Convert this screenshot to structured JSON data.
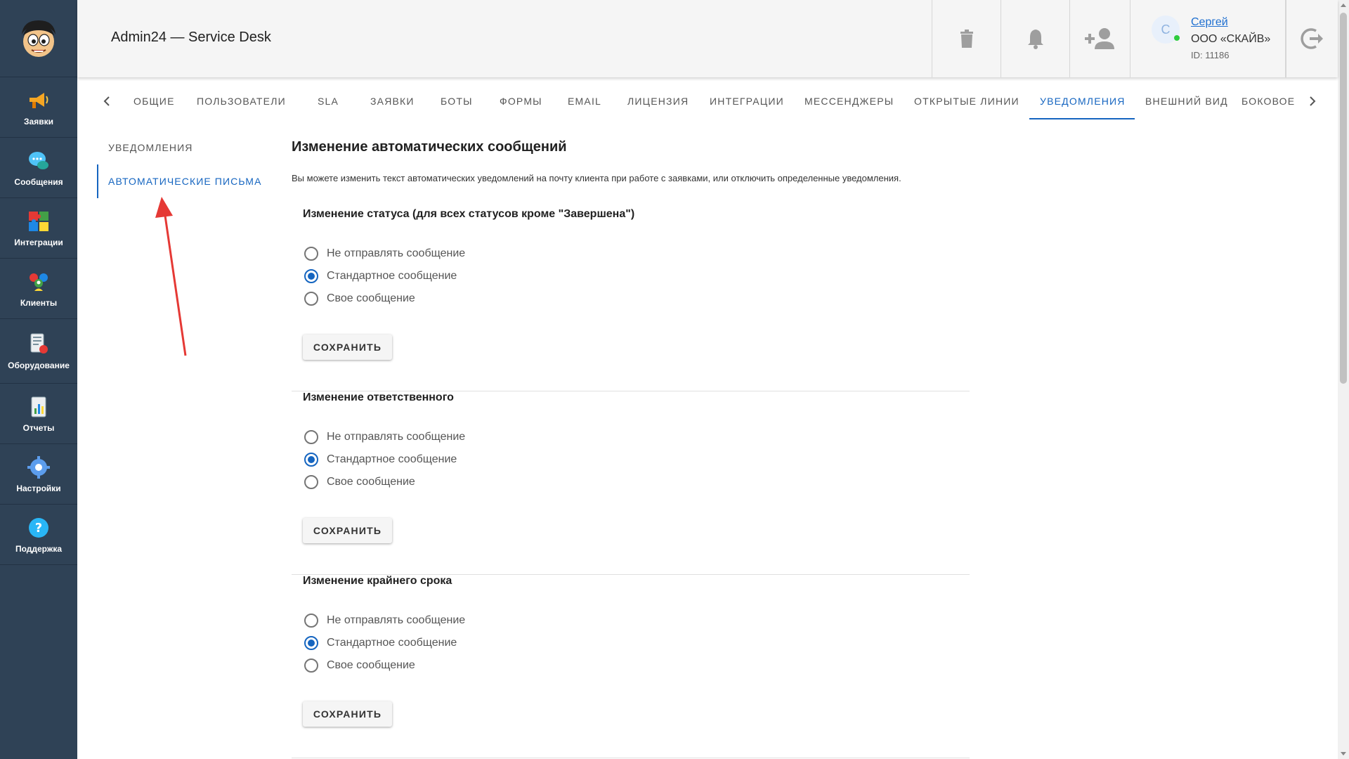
{
  "header": {
    "title": "Admin24 — Service Desk",
    "user": {
      "avatar_letter": "С",
      "name": "Сергей",
      "org": "ООО «СКАЙВ»",
      "id": "ID: 11186"
    }
  },
  "sidebar": {
    "items": [
      {
        "label": "Заявки",
        "icon": "megaphone-icon"
      },
      {
        "label": "Сообщения",
        "icon": "chat-bubble-icon"
      },
      {
        "label": "Интеграции",
        "icon": "puzzle-icon"
      },
      {
        "label": "Клиенты",
        "icon": "clients-icon"
      },
      {
        "label": "Оборудование",
        "icon": "equipment-icon"
      },
      {
        "label": "Отчеты",
        "icon": "report-icon"
      },
      {
        "label": "Настройки",
        "icon": "gear-icon"
      },
      {
        "label": "Поддержка",
        "icon": "help-icon"
      }
    ]
  },
  "tabs": {
    "items": [
      "ОБЩИЕ",
      "ПОЛЬЗОВАТЕЛИ",
      "SLA",
      "ЗАЯВКИ",
      "БОТЫ",
      "ФОРМЫ",
      "EMAIL",
      "ЛИЦЕНЗИЯ",
      "ИНТЕГРАЦИИ",
      "МЕССЕНДЖЕРЫ",
      "ОТКРЫТЫЕ ЛИНИИ",
      "УВЕДОМЛЕНИЯ",
      "ВНЕШНИЙ ВИД",
      "БОКОВОЕ"
    ],
    "active": "УВЕДОМЛЕНИЯ"
  },
  "subnav": {
    "items": [
      "УВЕДОМЛЕНИЯ",
      "АВТОМАТИЧЕСКИЕ ПИСЬМА"
    ],
    "active": "АВТОМАТИЧЕСКИЕ ПИСЬМА"
  },
  "content": {
    "title": "Изменение автоматических сообщений",
    "description": "Вы можете изменить текст автоматических уведомлений на почту клиента при работе с заявками, или отключить определенные уведомления.",
    "sections": [
      {
        "title": "Изменение статуса (для всех статусов кроме \"Завершена\")",
        "options": [
          "Не отправлять сообщение",
          "Стандартное сообщение",
          "Свое сообщение"
        ],
        "selected": 1,
        "save_label": "СОХРАНИТЬ"
      },
      {
        "title": "Изменение ответственного",
        "options": [
          "Не отправлять сообщение",
          "Стандартное сообщение",
          "Свое сообщение"
        ],
        "selected": 1,
        "save_label": "СОХРАНИТЬ"
      },
      {
        "title": "Изменение крайнего срока",
        "options": [
          "Не отправлять сообщение",
          "Стандартное сообщение",
          "Свое сообщение"
        ],
        "selected": 1,
        "save_label": "СОХРАНИТЬ"
      }
    ]
  },
  "colors": {
    "sidebar_bg": "#2f4256",
    "accent": "#1565c0",
    "annotation": "#e53935",
    "online": "#2ecc40"
  }
}
